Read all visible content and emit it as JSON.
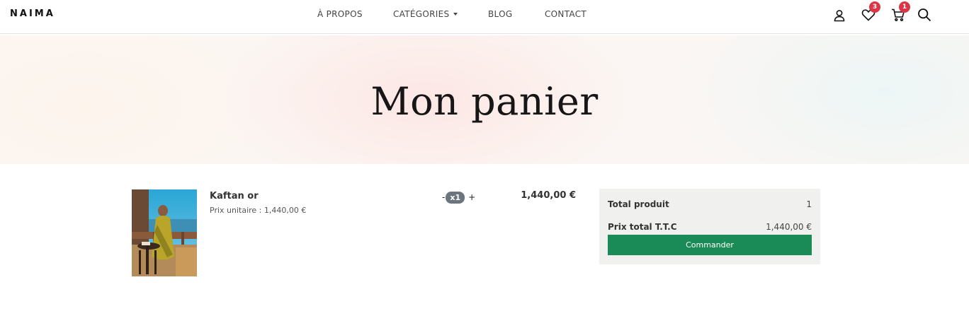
{
  "brand": {
    "logo_text": "NAIMA"
  },
  "nav": {
    "items": [
      {
        "label": "À PROPOS"
      },
      {
        "label": "CATÉGORIES"
      },
      {
        "label": "BLOG"
      },
      {
        "label": "CONTACT"
      }
    ]
  },
  "header_icons": {
    "user": {
      "icon": "user-icon"
    },
    "wishlist": {
      "icon": "heart-icon",
      "count": "3"
    },
    "cart": {
      "icon": "cart-icon",
      "count": "1"
    },
    "search": {
      "icon": "search-icon"
    }
  },
  "hero": {
    "title": "Mon panier"
  },
  "cart": {
    "items": [
      {
        "name": "Kaftan or",
        "unit_price_text": "Prix unitaire : 1,440,00 €",
        "qty_minus": "-",
        "quantity": "x1",
        "qty_plus": "+",
        "total": "1,440,00 €"
      }
    ]
  },
  "summary": {
    "total_products_label": "Total produit",
    "total_products_value": "1",
    "total_price_label": "Prix total T.T.C",
    "total_price_value": "1,440,00 €",
    "order_button": "Commander"
  },
  "colors": {
    "badge": "#dc3545",
    "order_button": "#1a8a56",
    "quantity_badge": "#6c757d",
    "summary_background": "#f0f0ee"
  }
}
